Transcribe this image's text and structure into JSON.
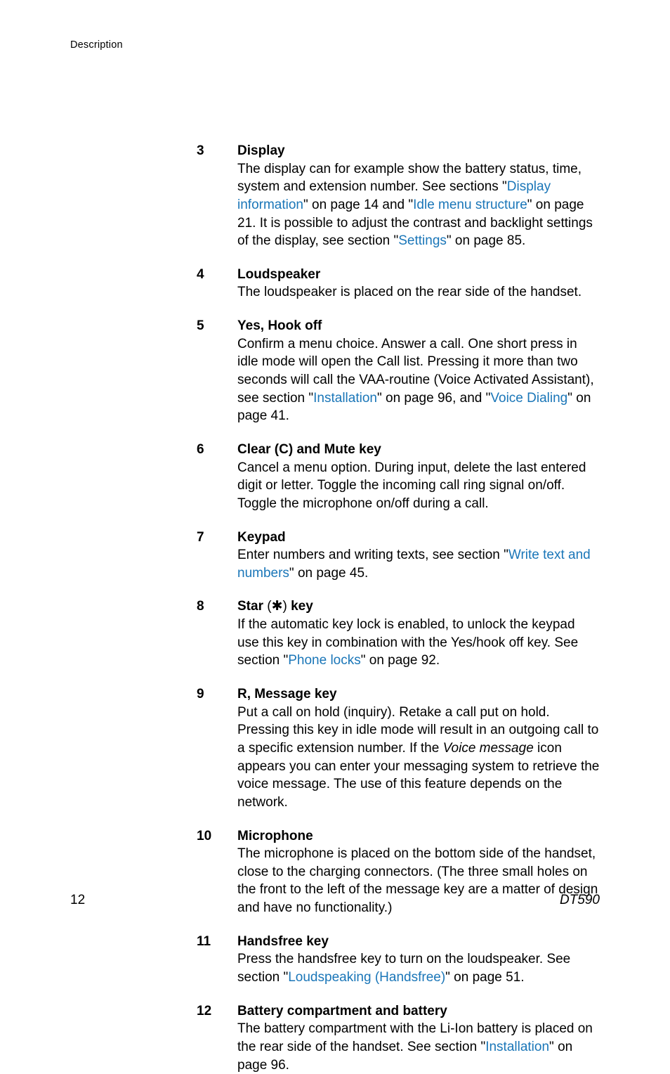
{
  "header": "Description",
  "items": [
    {
      "num": "3",
      "title": "Display",
      "segments": [
        {
          "t": "The display can for example show the battery status, time, system and extension number. See sections \""
        },
        {
          "t": "Display information",
          "link": true
        },
        {
          "t": "\" on page 14 and \""
        },
        {
          "t": "Idle menu structure",
          "link": true
        },
        {
          "t": "\" on page 21. It is possible to adjust the contrast and backlight settings of the display, see section \""
        },
        {
          "t": "Settings",
          "link": true
        },
        {
          "t": "\" on page 85."
        }
      ]
    },
    {
      "num": "4",
      "title": "Loudspeaker",
      "segments": [
        {
          "t": "The loudspeaker is placed on the rear side of the handset."
        }
      ]
    },
    {
      "num": "5",
      "title": "Yes, Hook off",
      "segments": [
        {
          "t": "Confirm a menu choice. Answer a call. One short press in idle mode will open the Call list. Pressing it more than two seconds will call the VAA-routine (Voice Activated Assistant), see section \""
        },
        {
          "t": "Installation",
          "link": true
        },
        {
          "t": "\" on page 96, and \""
        },
        {
          "t": "Voice Dialing",
          "link": true
        },
        {
          "t": "\" on page 41."
        }
      ]
    },
    {
      "num": "6",
      "title": "Clear (C) and Mute key",
      "segments": [
        {
          "t": "Cancel a menu option. During input, delete the last entered digit or letter. Toggle the incoming call ring signal on/off. Toggle the microphone on/off during a call."
        }
      ]
    },
    {
      "num": "7",
      "title": "Keypad",
      "segments": [
        {
          "t": "Enter numbers and writing texts, see section \""
        },
        {
          "t": "Write text and numbers",
          "link": true
        },
        {
          "t": "\" on page 45."
        }
      ]
    },
    {
      "num": "8",
      "title_segments": [
        {
          "t": "Star ",
          "bold": true
        },
        {
          "t": "(",
          "bold": false
        },
        {
          "t": "✱",
          "bold": false,
          "star": true
        },
        {
          "t": ")",
          "bold": false
        },
        {
          "t": " key",
          "bold": true
        }
      ],
      "segments": [
        {
          "t": "If the automatic key lock is enabled, to unlock the keypad use this key in combination with the Yes/hook off key. See section \""
        },
        {
          "t": "Phone locks",
          "link": true
        },
        {
          "t": "\" on page 92."
        }
      ]
    },
    {
      "num": "9",
      "title": "R, Message key",
      "segments": [
        {
          "t": "Put a call on hold (inquiry). Retake a call put on hold. Pressing this key in idle mode will result in an outgoing call to a specific extension number. If the "
        },
        {
          "t": "Voice message",
          "italic": true
        },
        {
          "t": " icon appears you can enter your messaging system to retrieve the voice message. The use of this feature depends on the network."
        }
      ]
    },
    {
      "num": "10",
      "title": "Microphone",
      "segments": [
        {
          "t": "The microphone is placed on the bottom side of the handset, close to the charging connectors. (The three small holes on the front to the left of the message key are a matter of design and have no functionality.)"
        }
      ]
    },
    {
      "num": "11",
      "title": "Handsfree key",
      "segments": [
        {
          "t": "Press the handsfree key to turn on the loudspeaker. See section \""
        },
        {
          "t": "Loudspeaking (Handsfree)",
          "link": true
        },
        {
          "t": "\" on page 51."
        }
      ]
    },
    {
      "num": "12",
      "title": "Battery compartment and battery",
      "segments": [
        {
          "t": "The battery compartment with the Li-Ion battery is placed on the rear side of the handset. See section \""
        },
        {
          "t": "Installation",
          "link": true
        },
        {
          "t": "\" on page 96."
        }
      ]
    }
  ],
  "footer": {
    "page": "12",
    "model": "DT590"
  }
}
